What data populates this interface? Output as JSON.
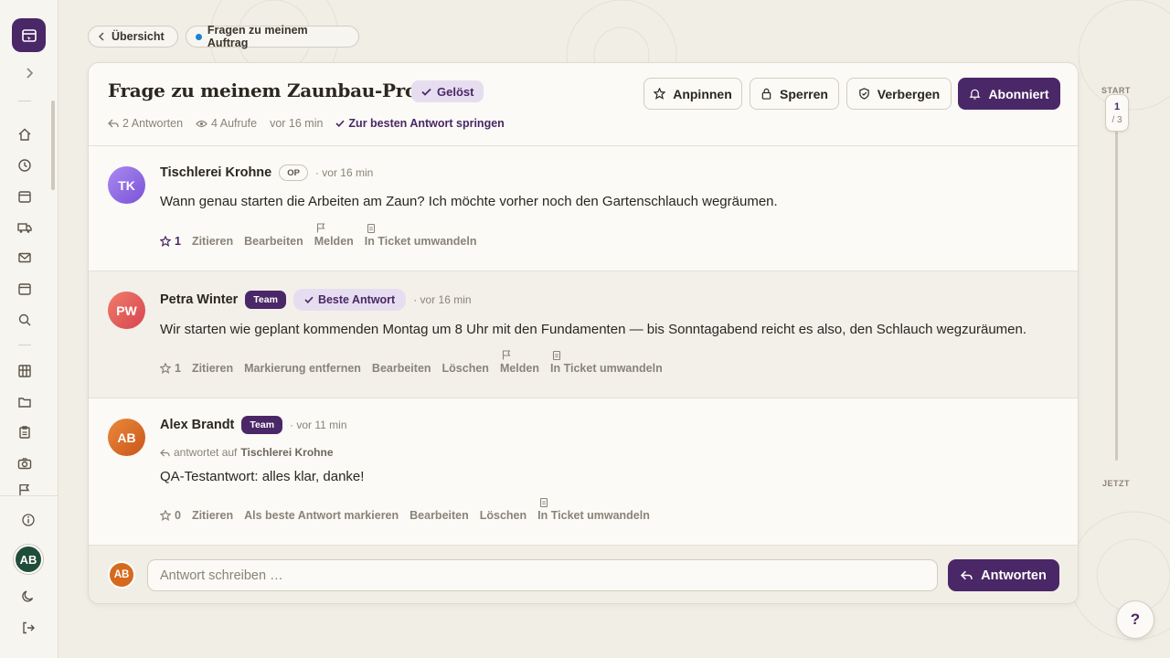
{
  "breadcrumb": {
    "back_label": "Übersicht",
    "current_label": "Fragen zu meinem Auftrag"
  },
  "thread": {
    "title": "Frage zu meinem Zaunbau-Projekt",
    "status": "Gelöst",
    "meta": {
      "answers": "2 Antworten",
      "views": "4 Aufrufe",
      "age": "vor 16 min",
      "jump": "Zur besten Antwort springen"
    },
    "buttons": {
      "pin": "Anpinnen",
      "lock": "Sperren",
      "hide": "Verbergen",
      "subscribed": "Abonniert"
    }
  },
  "posts": [
    {
      "initials": "TK",
      "author": "Tischlerei Krohne",
      "badge": "OP",
      "time": "· vor 16 min",
      "text": "Wann genau starten die Arbeiten am Zaun? Ich möchte vorher noch den Gartenschlauch wegräumen.",
      "likes": "1",
      "actions": {
        "quote": "Zitieren",
        "edit": "Bearbeiten",
        "report": "Melden",
        "ticket": "In Ticket umwandeln"
      }
    },
    {
      "initials": "PW",
      "author": "Petra Winter",
      "badge": "Team",
      "best_badge": "Beste Antwort",
      "time": "· vor 16 min",
      "text": "Wir starten wie geplant kommenden Montag um 8 Uhr mit den Fundamenten — bis Sonntagabend reicht es also, den Schlauch wegzuräumen.",
      "likes": "1",
      "actions": {
        "quote": "Zitieren",
        "unmark": "Markierung entfernen",
        "edit": "Bearbeiten",
        "delete": "Löschen",
        "report": "Melden",
        "ticket": "In Ticket umwandeln"
      }
    },
    {
      "initials": "AB",
      "author": "Alex Brandt",
      "badge": "Team",
      "time": "· vor 11 min",
      "reply_prefix": "antwortet auf",
      "reply_to": "Tischlerei Krohne",
      "text": "QA-Testantwort: alles klar, danke!",
      "likes": "0",
      "actions": {
        "quote": "Zitieren",
        "mark_best": "Als beste Antwort markieren",
        "edit": "Bearbeiten",
        "delete": "Löschen",
        "ticket": "In Ticket umwandeln"
      }
    }
  ],
  "composer": {
    "initials": "AB",
    "placeholder": "Antwort schreiben …",
    "submit": "Antworten"
  },
  "timeline": {
    "start": "START",
    "end": "JETZT",
    "current": "1",
    "total": "/ 3"
  },
  "user": {
    "initials": "AB"
  },
  "help": "?",
  "colors": {
    "accent": "#4a2766",
    "background": "#f1eee6",
    "card": "#fbfaf6",
    "avatar_tk": "#8f6be8",
    "avatar_pw": "#e05a57",
    "avatar_ab": "#d56a1e",
    "user_avatar": "#1f4d3a"
  },
  "icons": {
    "sidebar": [
      "home-icon",
      "clock-icon",
      "calendar-icon",
      "truck-icon",
      "mail-icon",
      "calendar-icon",
      "search-icon",
      "table-icon",
      "folder-icon",
      "clipboard-icon",
      "camera-icon",
      "flag-icon",
      "info-icon",
      "moon-icon",
      "logout-icon"
    ]
  }
}
